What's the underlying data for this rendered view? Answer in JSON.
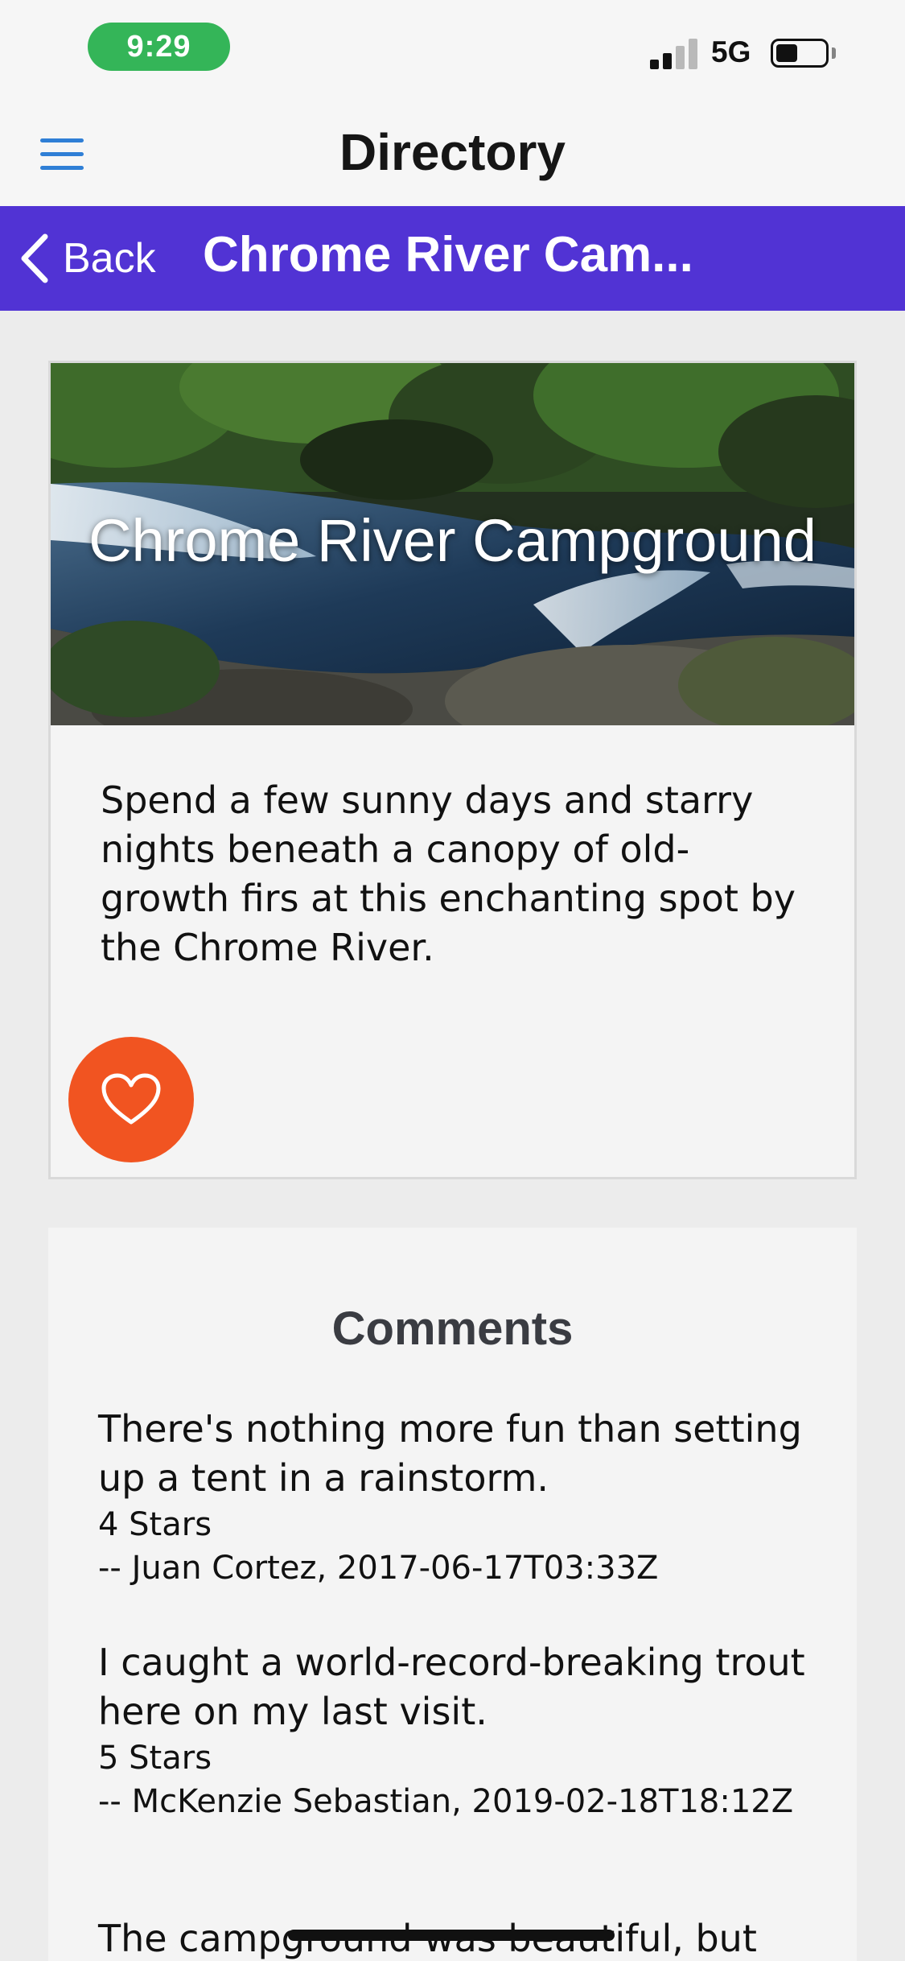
{
  "status_bar": {
    "time": "9:29",
    "network": "5G",
    "time_pill_color": "#34b558"
  },
  "header": {
    "title": "Directory",
    "menu_icon": "hamburger-menu-icon",
    "menu_icon_color": "#2f7fd6"
  },
  "nav": {
    "back_label": "Back",
    "title": "Chrome River Cam...",
    "background_color": "#5133d4"
  },
  "campsite": {
    "name": "Chrome River Campground",
    "description": "Spend a few sunny days and starry nights beneath a canopy of old-growth firs at this enchanting spot by the Chrome River.",
    "favorite_icon": "heart-outline-icon",
    "favorite_button_color": "#f15421"
  },
  "comments": {
    "title": "Comments",
    "items": [
      {
        "text": "There's nothing more fun than setting up a tent in a rainstorm.",
        "rating": "4 Stars",
        "byline": "-- Juan Cortez, 2017-06-17T03:33Z"
      },
      {
        "text": "I caught a world-record-breaking trout here on my last visit.",
        "rating": "5 Stars",
        "byline": "-- McKenzie Sebastian, 2019-02-18T18:12Z"
      },
      {
        "text": "The campground was beautiful, but"
      }
    ]
  }
}
